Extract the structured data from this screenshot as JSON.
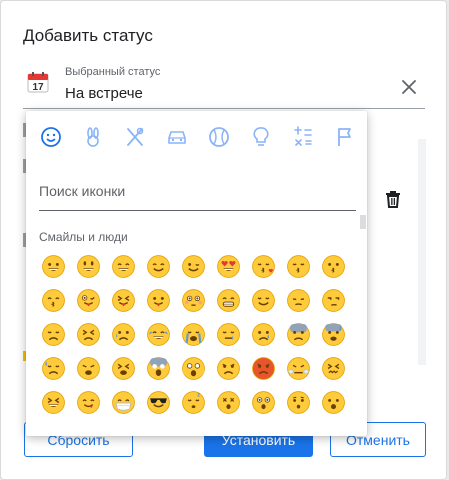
{
  "dialog": {
    "title": "Добавить статус",
    "field_label": "Выбранный статус",
    "field_value": "На встрече",
    "calendar_icon": "calendar-icon",
    "clear_icon": "close-icon",
    "delete_icon": "trash-icon"
  },
  "buttons": {
    "reset": "Сбросить",
    "set": "Установить",
    "cancel": "Отменить"
  },
  "picker": {
    "categories": [
      {
        "name": "smileys",
        "icon": "smiley-face-icon",
        "active": true
      },
      {
        "name": "animals",
        "icon": "rabbit-icon",
        "active": false
      },
      {
        "name": "food",
        "icon": "fork-knife-icon",
        "active": false
      },
      {
        "name": "travel",
        "icon": "car-icon",
        "active": false
      },
      {
        "name": "activities",
        "icon": "ball-icon",
        "active": false
      },
      {
        "name": "objects",
        "icon": "lightbulb-icon",
        "active": false
      },
      {
        "name": "symbols",
        "icon": "symbols-icon",
        "active": false
      },
      {
        "name": "flags",
        "icon": "flag-icon",
        "active": false
      }
    ],
    "search_placeholder": "Поиск иконки",
    "section_label": "Смайлы и люди",
    "emojis": [
      "grinning-face",
      "smiley-face",
      "grinning-wide",
      "smiling-face",
      "winking-face",
      "heart-eyes",
      "kissing-heart",
      "kissing-closed-eyes",
      "kissing-face",
      "kissing-smiling-eyes",
      "tongue-wink",
      "tongue-squint",
      "tongue-out",
      "flushed",
      "beaming",
      "relieved",
      "pensive",
      "unamused",
      "disappointed",
      "persevering",
      "crying",
      "tears-of-joy",
      "loudly-crying",
      "sleepy",
      "sad-relieved",
      "fearful",
      "cold-sweat",
      "downcast-sweat",
      "weary",
      "tired",
      "screaming-fear",
      "screaming",
      "pouting",
      "angry",
      "triumph",
      "confounded",
      "laughing",
      "yum",
      "mask",
      "sunglasses",
      "sleeping",
      "dizzy",
      "astonished",
      "hushed",
      "open-mouth"
    ],
    "colors": {
      "face": "#fdcb3b",
      "outline": "#e5a100",
      "accent": "#1a73e8",
      "icon_gray": "#5f6368",
      "cat_icon": "#8ab4f8"
    }
  }
}
